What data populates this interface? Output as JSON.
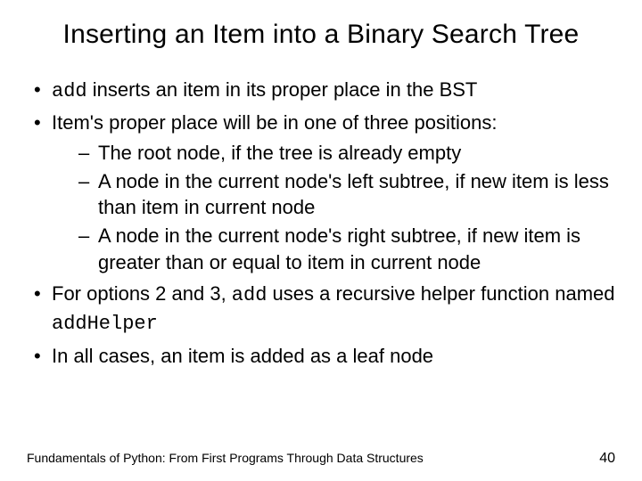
{
  "title": "Inserting an Item into a Binary Search Tree",
  "bullets": [
    {
      "prefix_code": "add",
      "text_after": " inserts an item in its proper place in the BST"
    },
    {
      "text": "Item's proper place will be in one of three positions:",
      "sub": [
        "The root node, if the tree is already empty",
        "A node in the current node's left subtree, if new item is less than item in current node",
        "A node in the current node's right subtree, if new item is greater than or equal to item in current node"
      ]
    },
    {
      "text_before": "For options 2 and 3, ",
      "code1": "add",
      "text_mid": " uses a recursive helper function named ",
      "code2": "addHelper"
    },
    {
      "text": "In all cases, an item is added as a leaf node"
    }
  ],
  "footer": {
    "source": "Fundamentals of Python: From First Programs Through Data Structures",
    "page": "40"
  }
}
